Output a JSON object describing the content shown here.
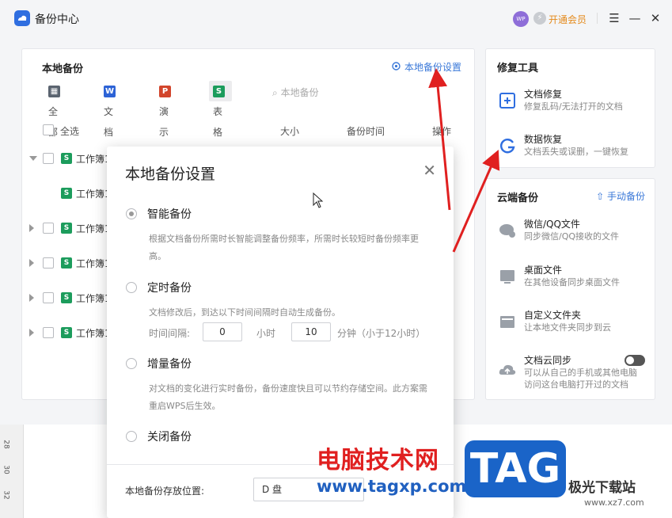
{
  "window": {
    "title": "备份中心",
    "avatar_text": "WP",
    "vip_label": "开通会员",
    "menu_glyph": "☰",
    "minimize_glyph": "—",
    "close_glyph": "✕"
  },
  "local_backup": {
    "title": "本地备份",
    "settings_link": "本地备份设置",
    "tabs": [
      {
        "label": "全部",
        "icon_text": "▦",
        "color": "#5b6470"
      },
      {
        "label": "文档",
        "icon_text": "W",
        "color": "#2d63d6"
      },
      {
        "label": "演示",
        "icon_text": "P",
        "color": "#d2452c"
      },
      {
        "label": "表格",
        "icon_text": "S",
        "color": "#1c9c5c"
      }
    ],
    "search_placeholder": "本地备份",
    "columns": {
      "select_all": "全选",
      "size": "大小",
      "time": "备份时间",
      "action": "操作"
    },
    "rows": [
      {
        "name": "工作簿1",
        "expanded": true
      },
      {
        "name": "工作簿1",
        "child": true
      },
      {
        "name": "工作簿1"
      },
      {
        "name": "工作簿1"
      },
      {
        "name": "工作簿1"
      },
      {
        "name": "工作簿1"
      }
    ]
  },
  "repair_tools": {
    "title": "修复工具",
    "items": [
      {
        "title": "文档修复",
        "desc": "修复乱码/无法打开的文档"
      },
      {
        "title": "数据恢复",
        "desc": "文档丢失或误删，一键恢复"
      }
    ]
  },
  "cloud_backup": {
    "title": "云端备份",
    "manual_link": "手动备份",
    "items": [
      {
        "title": "微信/QQ文件",
        "desc": "同步微信/QQ接收的文件"
      },
      {
        "title": "桌面文件",
        "desc": "在其他设备同步桌面文件"
      },
      {
        "title": "自定义文件夹",
        "desc": "让本地文件夹同步到云"
      },
      {
        "title": "文档云同步",
        "desc": "可以从自己的手机或其他电脑",
        "desc2": "访问这台电脑打开过的文档",
        "toggle_on": true
      }
    ]
  },
  "ruler": {
    "marks": [
      "28",
      "30",
      "32"
    ]
  },
  "modal": {
    "title": "本地备份设置",
    "close_glyph": "✕",
    "options": [
      {
        "label": "智能备份",
        "selected": true,
        "desc": "根据文档备份所需时长智能调整备份频率，所需时长较短时备份频率更高。"
      },
      {
        "label": "定时备份",
        "selected": false,
        "desc": "文档修改后，到达以下时间间隔时自动生成备份。"
      },
      {
        "label": "增量备份",
        "selected": false,
        "desc": "对文档的变化进行实时备份，备份速度快且可以节约存储空间。此方案需重启WPS后生效。"
      },
      {
        "label": "关闭备份",
        "selected": false,
        "desc": ""
      }
    ],
    "interval": {
      "label": "时间间隔:",
      "hours_value": "0",
      "hours_unit": "小时",
      "minutes_value": "10",
      "minutes_unit": "分钟（小于12小时）"
    },
    "location_label": "本地备份存放位置:",
    "location_value": "D 盘"
  },
  "watermark": {
    "site_cn": "电脑技术网",
    "site_url": "www.tagxp.com",
    "tag": "TAG",
    "brand": "极光下载站",
    "brand_url": "www.xz7.com"
  },
  "colors": {
    "accent": "#3a78d8",
    "vip": "#e48a1c",
    "sheet_green": "#1c9c5c",
    "arrow_red": "#e02020"
  }
}
